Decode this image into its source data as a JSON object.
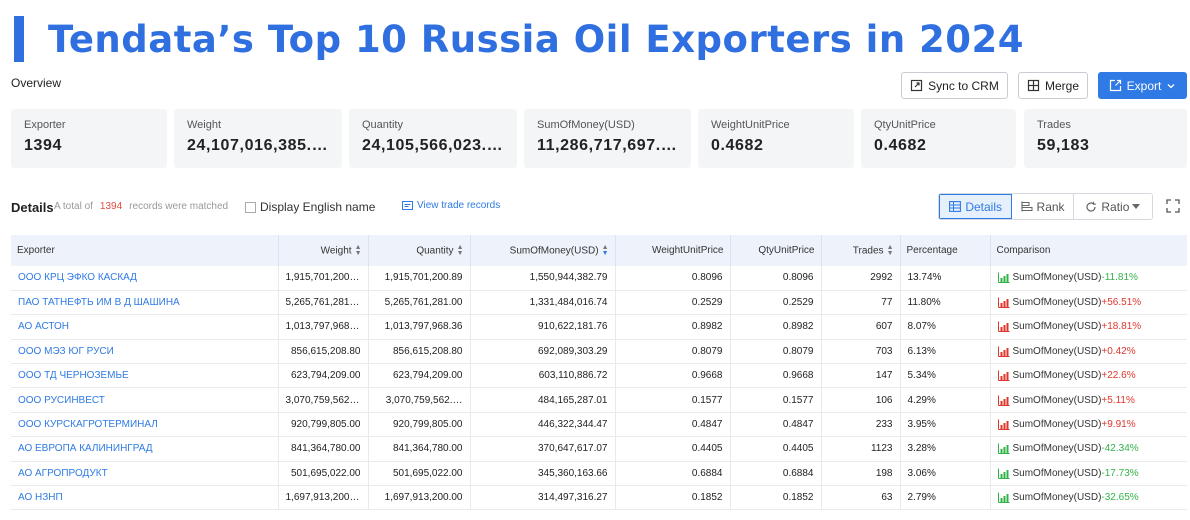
{
  "title": "Tendata’s Top 10 Russia Oil Exporters in 2024",
  "overview_label": "Overview",
  "toolbar": {
    "sync_label": "Sync to CRM",
    "merge_label": "Merge",
    "export_label": "Export"
  },
  "stats": [
    {
      "label": "Exporter",
      "value": "1394"
    },
    {
      "label": "Weight",
      "value": "24,107,016,385.…"
    },
    {
      "label": "Quantity",
      "value": "24,105,566,023.…"
    },
    {
      "label": "SumOfMoney(USD)",
      "value": "11,286,717,697.…"
    },
    {
      "label": "WeightUnitPrice",
      "value": "0.4682"
    },
    {
      "label": "QtyUnitPrice",
      "value": "0.4682"
    },
    {
      "label": "Trades",
      "value": "59,183"
    }
  ],
  "details": {
    "label": "Details",
    "total_prefix": "A total of",
    "total_count": "1394",
    "total_suffix": "records were matched",
    "display_english": "Display English name",
    "view_records": "View trade records",
    "view_details": "Details",
    "view_rank": "Rank",
    "view_ratio": "Ratio"
  },
  "table": {
    "headers": {
      "exporter": "Exporter",
      "weight": "Weight",
      "quantity": "Quantity",
      "money": "SumOfMoney(USD)",
      "wup": "WeightUnitPrice",
      "qup": "QtyUnitPrice",
      "trades": "Trades",
      "percentage": "Percentage",
      "comparison": "Comparison"
    },
    "comparison_label": "SumOfMoney(USD)",
    "up_color": "#e0362c",
    "down_color": "#32b34a",
    "rows": [
      {
        "exporter": "ООО КРЦ ЭФКО КАСКАД",
        "weight": "1,915,701,200.…",
        "quantity": "1,915,701,200.89",
        "money": "1,550,944,382.79",
        "wup": "0.8096",
        "qup": "0.8096",
        "trades": "2992",
        "percentage": "13.74%",
        "change": "-11.81%",
        "direction": "down"
      },
      {
        "exporter": "ПАО ТАТНЕФТЬ ИМ В Д ШАШИНА",
        "weight": "5,265,761,281.…",
        "quantity": "5,265,761,281.00",
        "money": "1,331,484,016.74",
        "wup": "0.2529",
        "qup": "0.2529",
        "trades": "77",
        "percentage": "11.80%",
        "change": "+56.51%",
        "direction": "up"
      },
      {
        "exporter": "АО АСТОН",
        "weight": "1,013,797,968.…",
        "quantity": "1,013,797,968.36",
        "money": "910,622,181.76",
        "wup": "0.8982",
        "qup": "0.8982",
        "trades": "607",
        "percentage": "8.07%",
        "change": "+18.81%",
        "direction": "up"
      },
      {
        "exporter": "ООО МЭЗ ЮГ РУСИ",
        "weight": "856,615,208.80",
        "quantity": "856,615,208.80",
        "money": "692,089,303.29",
        "wup": "0.8079",
        "qup": "0.8079",
        "trades": "703",
        "percentage": "6.13%",
        "change": "+0.42%",
        "direction": "up"
      },
      {
        "exporter": "ООО ТД ЧЕРНОЗЕМЬЕ",
        "weight": "623,794,209.00",
        "quantity": "623,794,209.00",
        "money": "603,110,886.72",
        "wup": "0.9668",
        "qup": "0.9668",
        "trades": "147",
        "percentage": "5.34%",
        "change": "+22.6%",
        "direction": "up"
      },
      {
        "exporter": "ООО РУСИНВЕСТ",
        "weight": "3,070,759,562.…",
        "quantity": "3,070,759,562.…",
        "money": "484,165,287.01",
        "wup": "0.1577",
        "qup": "0.1577",
        "trades": "106",
        "percentage": "4.29%",
        "change": "+5.11%",
        "direction": "up"
      },
      {
        "exporter": "ООО КУРСКАГРОТЕРМИНАЛ",
        "weight": "920,799,805.00",
        "quantity": "920,799,805.00",
        "money": "446,322,344.47",
        "wup": "0.4847",
        "qup": "0.4847",
        "trades": "233",
        "percentage": "3.95%",
        "change": "+9.91%",
        "direction": "up"
      },
      {
        "exporter": "АО ЕВРОПА КАЛИНИНГРАД",
        "weight": "841,364,780.00",
        "quantity": "841,364,780.00",
        "money": "370,647,617.07",
        "wup": "0.4405",
        "qup": "0.4405",
        "trades": "1123",
        "percentage": "3.28%",
        "change": "-42.34%",
        "direction": "down"
      },
      {
        "exporter": "АО АГРОПРОДУКТ",
        "weight": "501,695,022.00",
        "quantity": "501,695,022.00",
        "money": "345,360,163.66",
        "wup": "0.6884",
        "qup": "0.6884",
        "trades": "198",
        "percentage": "3.06%",
        "change": "-17.73%",
        "direction": "down"
      },
      {
        "exporter": "АО НЗНП",
        "weight": "1,697,913,200.…",
        "quantity": "1,697,913,200.00",
        "money": "314,497,316.27",
        "wup": "0.1852",
        "qup": "0.1852",
        "trades": "63",
        "percentage": "2.79%",
        "change": "-32.65%",
        "direction": "down"
      }
    ]
  }
}
